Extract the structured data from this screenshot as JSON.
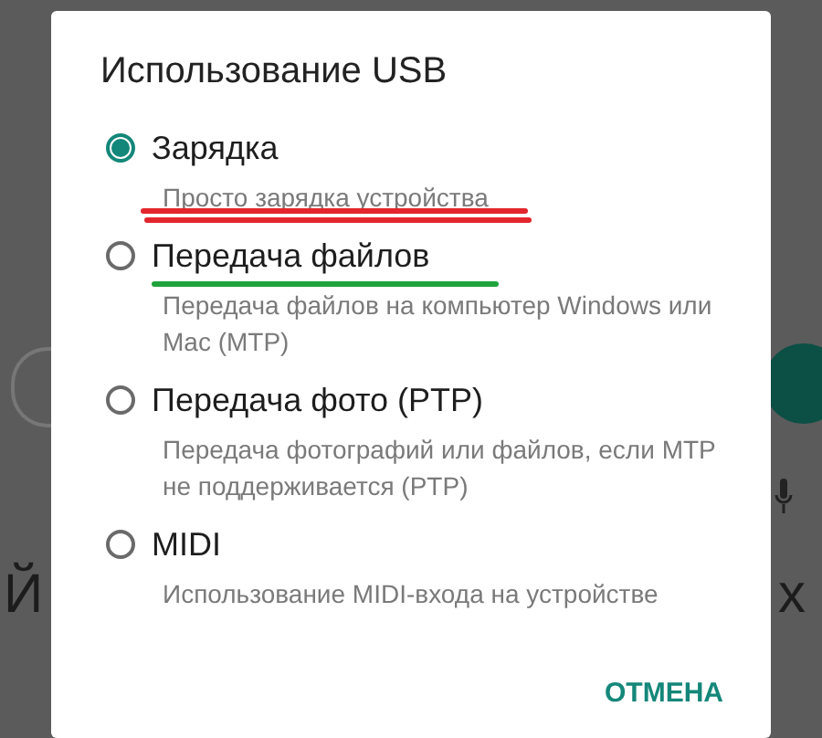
{
  "background": {
    "left_letter": "Й",
    "right_letter": "х"
  },
  "dialog": {
    "title": "Использование USB",
    "options": [
      {
        "label": "Зарядка",
        "description": "Просто зарядка устройства",
        "selected": true,
        "underline": {
          "kind": "description",
          "color": "#e3262d"
        }
      },
      {
        "label": "Передача файлов",
        "description": "Передача файлов на компьютер Windows или Mac (MTP)",
        "selected": false,
        "underline": {
          "kind": "label",
          "color": "#1fa33c"
        }
      },
      {
        "label": "Передача фото (PTP)",
        "description": "Передача фотографий или файлов, если MTP не поддерживается (PTP)",
        "selected": false
      },
      {
        "label": "MIDI",
        "description": "Использование MIDI-входа на устройстве",
        "selected": false
      }
    ],
    "buttons": [
      "ОТМЕНА"
    ]
  }
}
